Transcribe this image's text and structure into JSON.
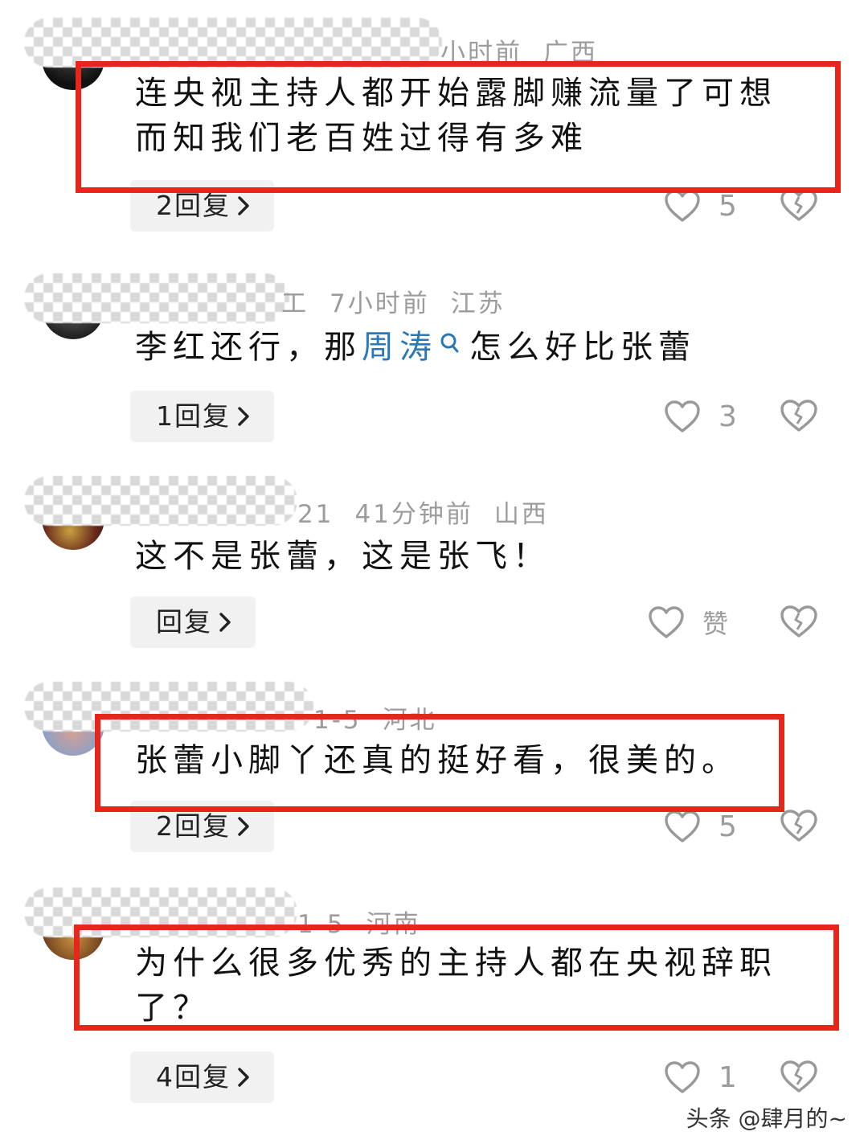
{
  "comments": [
    {
      "meta": {
        "time": "小时前",
        "location": "广西"
      },
      "text": "连央视主持人都开始露脚赚流量了可想而知我们老百姓过得有多难",
      "reply_label": "2回复",
      "likes": "5"
    },
    {
      "meta": {
        "name_tail": "工",
        "time": "7小时前",
        "location": "江苏"
      },
      "text_before": "李红还行，那",
      "link_text": "周涛",
      "text_after": "怎么好比张蕾",
      "reply_label": "1回复",
      "likes": "3"
    },
    {
      "meta": {
        "name_tail": "21",
        "time": "41分钟前",
        "location": "山西"
      },
      "text": "这不是张蕾，这是张飞！",
      "reply_label": "回复",
      "likes": "赞"
    },
    {
      "meta": {
        "time": "1-5",
        "location": "河北"
      },
      "text": "张蕾小脚丫还真的挺好看，很美的。",
      "reply_label": "2回复",
      "likes": "5"
    },
    {
      "meta": {
        "time": "1-5",
        "location": "河南"
      },
      "text": "为什么很多优秀的主持人都在央视辞职了？",
      "reply_label": "4回复",
      "likes": "1"
    }
  ],
  "footer": {
    "watermark": "头条 @肆月的~"
  },
  "colors": {
    "highlight_box": "#e8251a",
    "link": "#2a78b8",
    "muted": "#9c9c9c",
    "reply_bg": "#f1f1f1"
  },
  "icons": [
    "search-icon",
    "chevron-right-icon",
    "heart-icon",
    "broken-heart-icon"
  ]
}
